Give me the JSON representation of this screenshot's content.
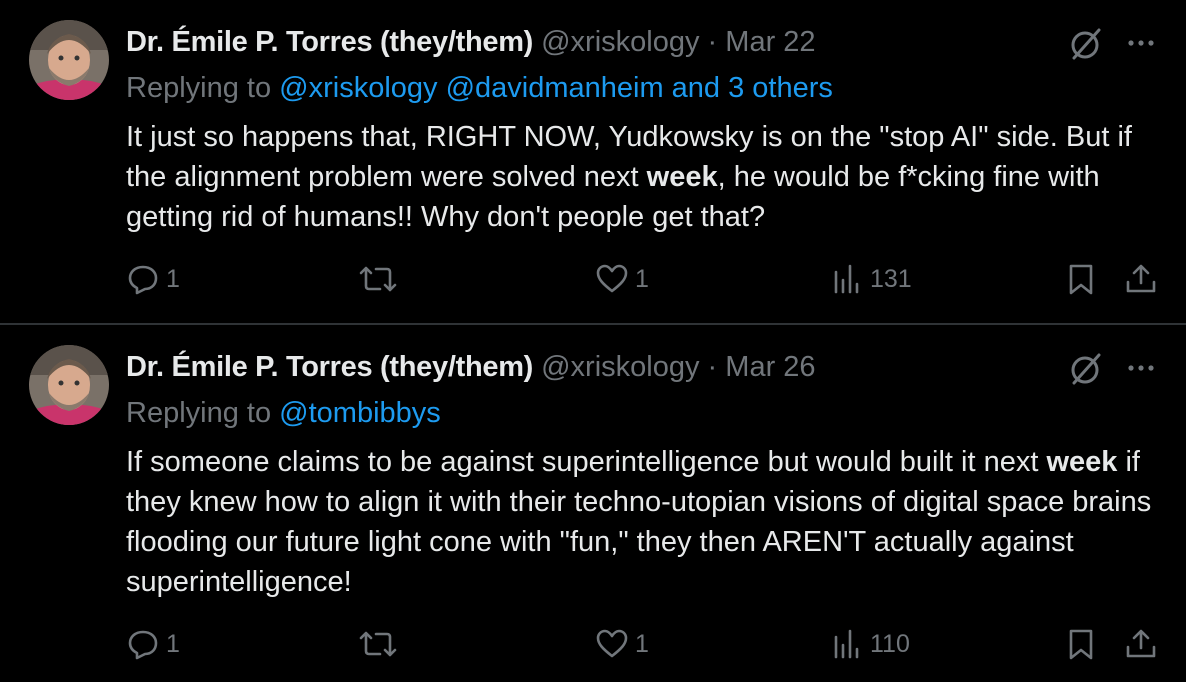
{
  "tweets": [
    {
      "author_name": "Dr. Émile P. Torres (they/them)",
      "handle": "@xriskology",
      "separator": "·",
      "date": "Mar 22",
      "replying_prefix": "Replying to",
      "replying_to": "@xriskology @davidmanheim and 3 others",
      "text_before": "It just so happens that, RIGHT NOW, Yudkowsky is on the \"stop AI\" side. But if the alignment problem were solved next ",
      "text_bold": "week",
      "text_after": ", he would be f*cking fine with getting rid of humans!! Why don't people get that?",
      "reply_count": "1",
      "retweet_count": "",
      "like_count": "1",
      "view_count": "131",
      "icons": [
        "reply-icon",
        "retweet-icon",
        "like-icon",
        "views-icon",
        "bookmark-icon",
        "share-icon"
      ]
    },
    {
      "author_name": "Dr. Émile P. Torres (they/them)",
      "handle": "@xriskology",
      "separator": "·",
      "date": "Mar 26",
      "replying_prefix": "Replying to",
      "replying_to": "@tombibbys",
      "text_before": "If someone claims to be against superintelligence but would built it next ",
      "text_bold": "week",
      "text_after": " if they knew how to align it with their techno-utopian visions of digital space brains flooding our future light cone with \"fun,\" they then AREN'T actually against superintelligence!",
      "reply_count": "1",
      "retweet_count": "",
      "like_count": "1",
      "view_count": "110",
      "icons": [
        "reply-icon",
        "retweet-icon",
        "like-icon",
        "views-icon",
        "bookmark-icon",
        "share-icon"
      ]
    }
  ],
  "colors": {
    "background": "#000000",
    "text_primary": "#e7e9ea",
    "text_secondary": "#71767b",
    "link": "#1d9bf0",
    "divider": "#2f3336"
  }
}
